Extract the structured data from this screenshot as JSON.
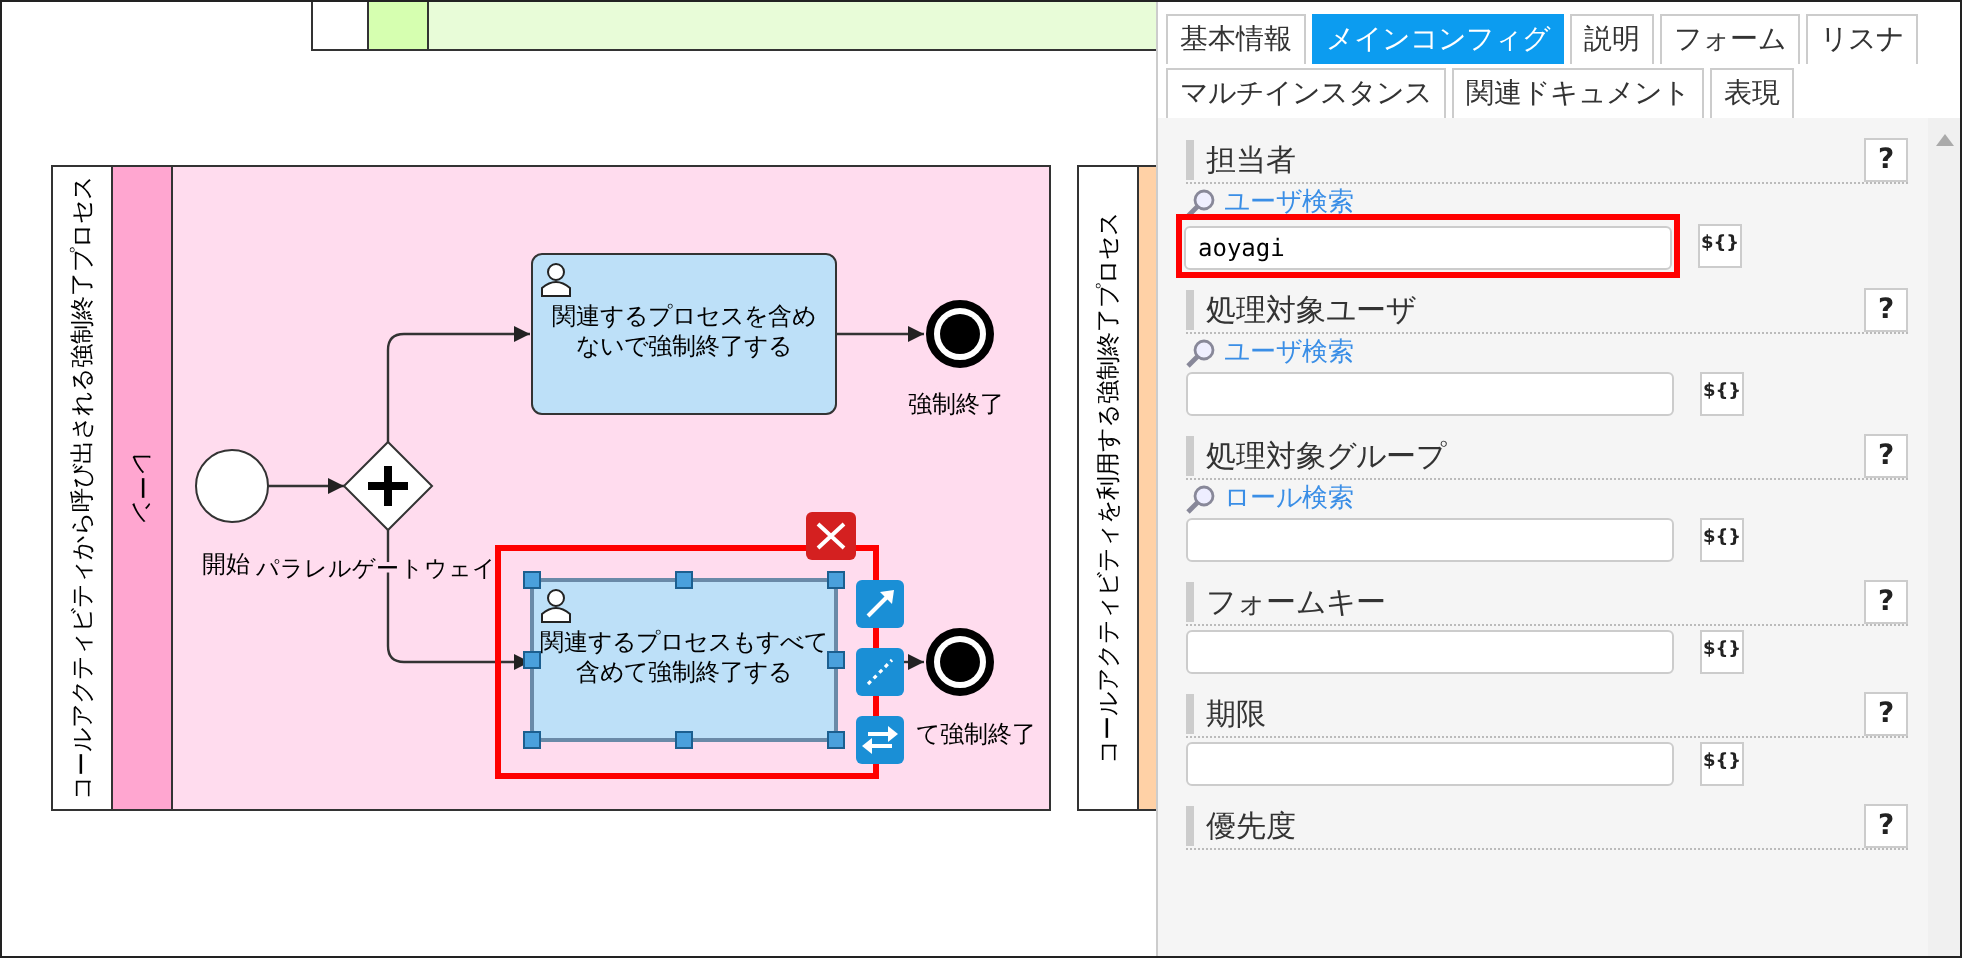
{
  "diagram": {
    "pools": [
      {
        "kind": "pool",
        "lanes": [
          {
            "kind": "lane"
          }
        ]
      },
      {
        "kind": "pool",
        "label": "コールアクティビティから呼び出される強制終了プロセス",
        "lanes": [
          {
            "kind": "lane",
            "label": "レーン"
          }
        ]
      },
      {
        "kind": "pool",
        "label": "コールアクティビティを利用する強制終了プロセス"
      }
    ],
    "nodes": [
      {
        "kind": "start",
        "label": "開始"
      },
      {
        "kind": "gateway",
        "label": "パラレルゲートウェイ"
      },
      {
        "kind": "task",
        "lines": [
          "関連するプロセスを含め",
          "ないで強制終了する"
        ],
        "selected": false
      },
      {
        "kind": "end",
        "label": "強制終了"
      },
      {
        "kind": "task",
        "lines": [
          "関連するプロセスもすべて",
          "含めて強制終了する"
        ],
        "selected": true
      },
      {
        "kind": "end",
        "label": "て強制終了"
      }
    ]
  },
  "panel": {
    "tabs": [
      {
        "label": "基本情報",
        "selected": false
      },
      {
        "label": "メインコンフィグ",
        "selected": true
      },
      {
        "label": "説明",
        "selected": false
      },
      {
        "label": "フォーム",
        "selected": false
      },
      {
        "label": "リスナ",
        "selected": false
      },
      {
        "label": "マルチインスタンス",
        "selected": false
      },
      {
        "label": "関連ドキュメント",
        "selected": false
      },
      {
        "label": "表現",
        "selected": false
      }
    ],
    "sections": [
      {
        "title": "担当者",
        "help": "?",
        "link": "ユーザ検索",
        "value": "aoyagi",
        "expr": "${}",
        "highlighted": true
      },
      {
        "title": "処理対象ユーザ",
        "help": "?",
        "link": "ユーザ検索",
        "expr": "${}"
      },
      {
        "title": "処理対象グループ",
        "help": "?",
        "link": "ロール検索",
        "expr": "${}"
      },
      {
        "title": "フォームキー",
        "help": "?",
        "expr": "${}"
      },
      {
        "title": "期限",
        "help": "?",
        "expr": "${}"
      },
      {
        "title": "優先度",
        "help": "?"
      }
    ]
  }
}
